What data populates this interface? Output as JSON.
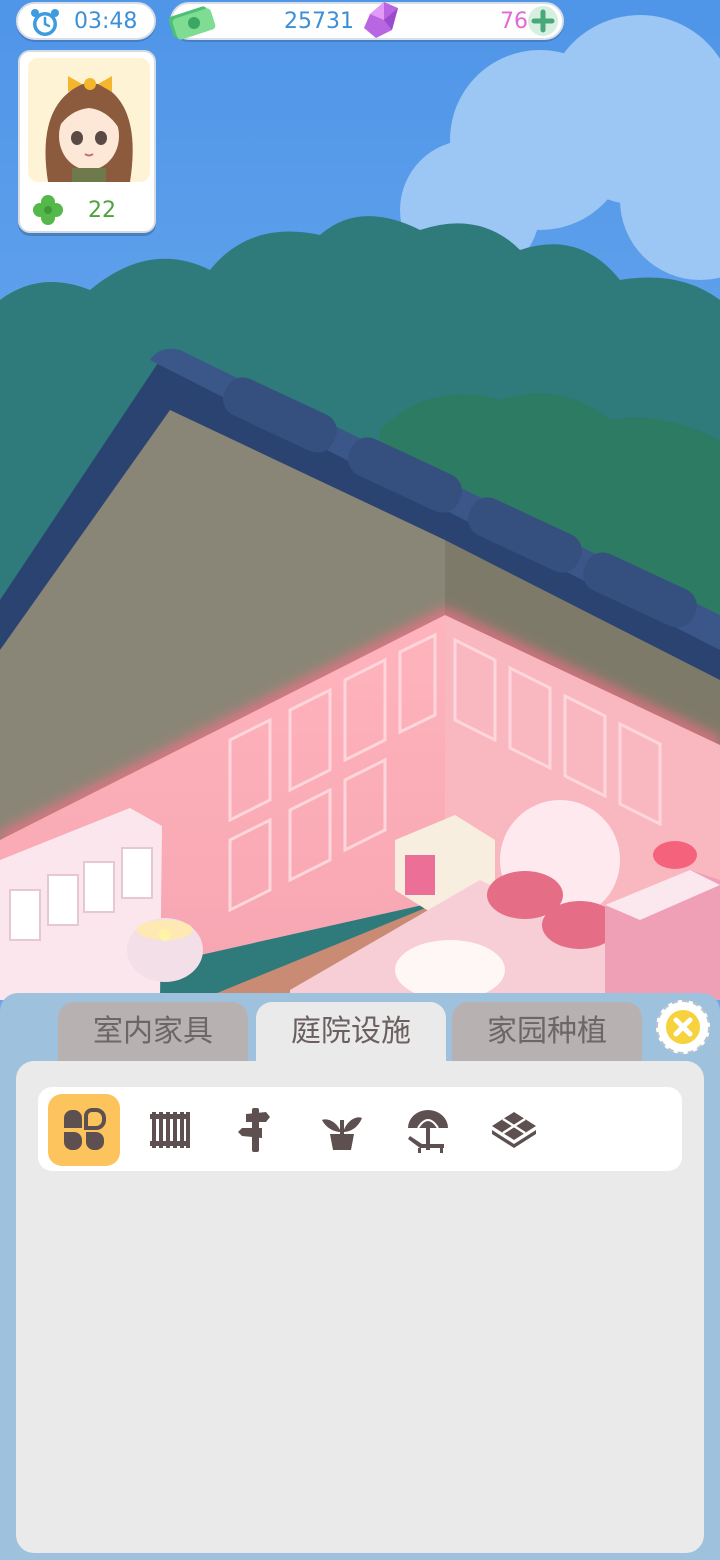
{
  "hud": {
    "time": "03:48",
    "cash": "25731",
    "gems": "76",
    "clovers": "22"
  },
  "panel": {
    "tabs": [
      {
        "label": "室内家具",
        "active": false
      },
      {
        "label": "庭院设施",
        "active": true
      },
      {
        "label": "家园种植",
        "active": false
      }
    ],
    "categories": [
      {
        "icon": "clover-leaves-icon",
        "active": true
      },
      {
        "icon": "fence-icon",
        "active": false
      },
      {
        "icon": "signpost-icon",
        "active": false
      },
      {
        "icon": "potted-plant-icon",
        "active": false
      },
      {
        "icon": "parasol-lounger-icon",
        "active": false
      },
      {
        "icon": "floor-tiles-icon",
        "active": false
      }
    ]
  },
  "colors": {
    "accent_blue": "#3d8fd6",
    "gem_pink": "#e06ad7",
    "clover_green": "#4ea33b",
    "active_category": "#fdc45e"
  }
}
